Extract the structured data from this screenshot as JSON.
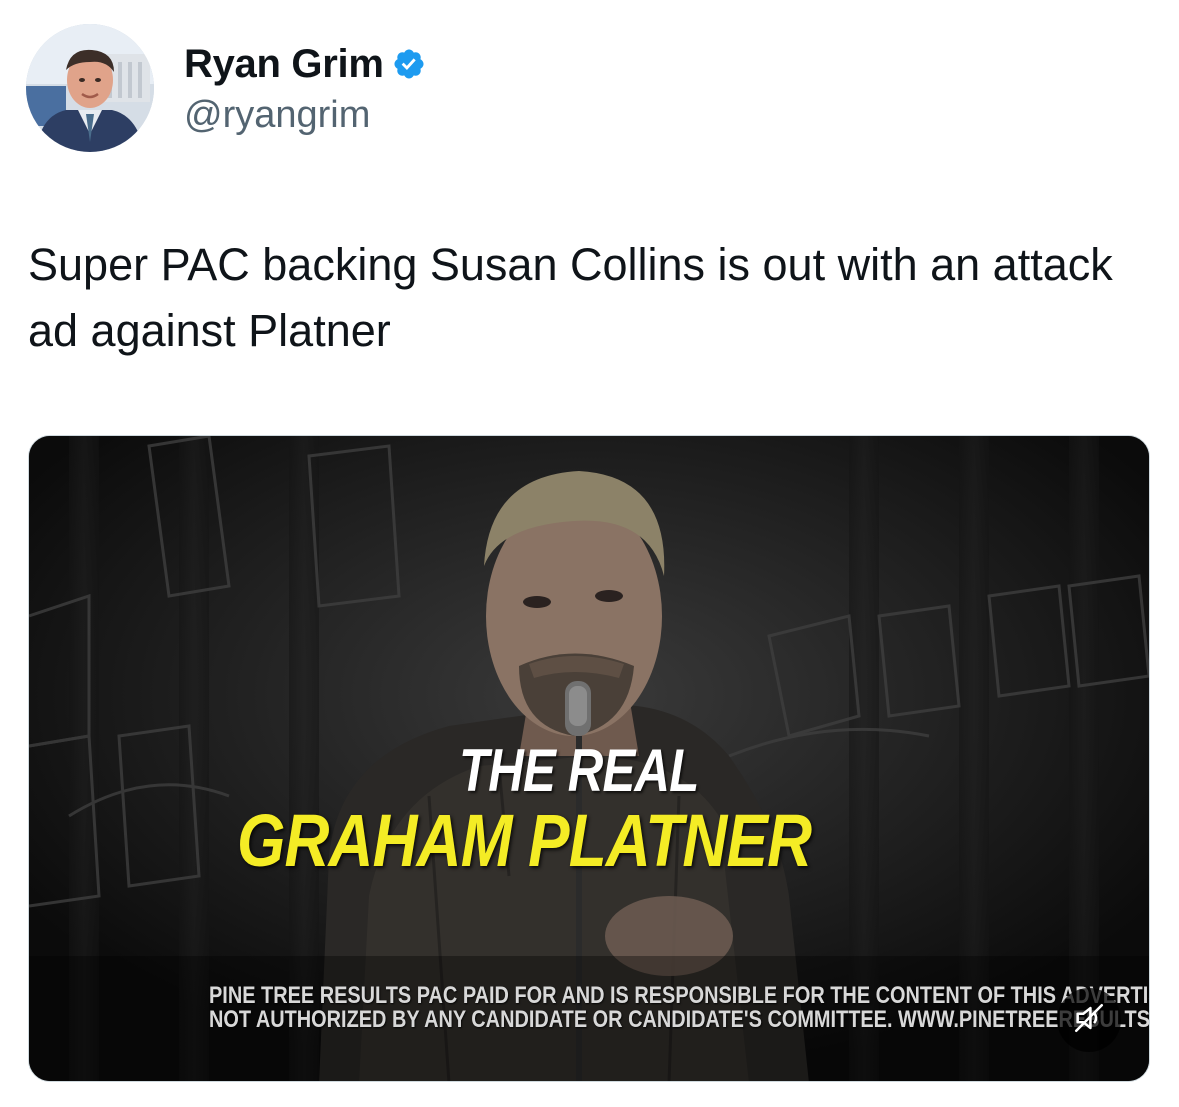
{
  "author": {
    "display_name": "Ryan Grim",
    "handle": "@ryangrim",
    "verified": true,
    "verified_icon": "verified-badge-icon",
    "accent_color": "#1d9bf0"
  },
  "tweet": {
    "text": "Super PAC backing Susan Collins is out with an attack ad against Platner"
  },
  "media": {
    "type": "video",
    "headline_line1": "THE REAL",
    "headline_line2": "GRAHAM PLATNER",
    "headline_color": "#f4ec25",
    "disclaimer_line1": "PINE TREE RESULTS PAC PAID FOR AND IS RESPONSIBLE FOR THE CONTENT OF THIS ADVERTISING.",
    "disclaimer_line2": "NOT AUTHORIZED BY ANY CANDIDATE OR CANDIDATE'S COMMITTEE. WWW.PINETREERESULTS.COM",
    "mute_icon": "speaker-muted-icon",
    "mute_label": "Unmute"
  }
}
